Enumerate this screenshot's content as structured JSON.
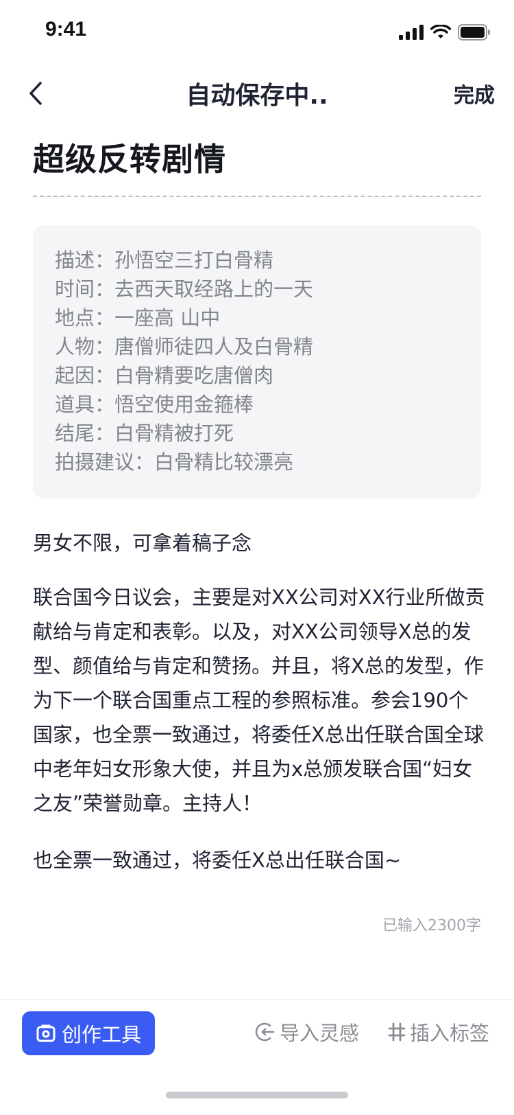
{
  "status_bar": {
    "time": "9:41"
  },
  "nav": {
    "title": "自动保存中..",
    "done_label": "完成"
  },
  "document": {
    "title": "超级反转剧情",
    "info": [
      {
        "label": "描述：",
        "value": "孙悟空三打白骨精"
      },
      {
        "label": "时间：",
        "value": "去西天取经路上的一天"
      },
      {
        "label": "地点：",
        "value": "一座高 山中"
      },
      {
        "label": "人物：",
        "value": "唐僧师徒四人及白骨精"
      },
      {
        "label": "起因：",
        "value": "白骨精要吃唐僧肉"
      },
      {
        "label": "道具：",
        "value": "悟空使用金箍棒"
      },
      {
        "label": "结尾：",
        "value": "白骨精被打死"
      },
      {
        "label": "拍摄建议：",
        "value": "白骨精比较漂亮"
      }
    ],
    "paragraphs": [
      "男女不限，可拿着稿子念",
      "联合国今日议会，主要是对XX公司对XX行业所做贡献给与肯定和表彰。以及，对XX公司领导X总的发型、颜值给与肯定和赞扬。并且，将X总的发型，作为下一个联合国重点工程的参照标准。参会190个国家，也全票一致通过，将委任X总出任联合国全球中老年妇女形象大使，并且为x总颁发联合国“妇女之友”荣誉勋章。主持人！",
      "也全票一致通过，将委任X总出任联合国~"
    ],
    "word_count": "已输入2300字"
  },
  "toolbar": {
    "create_tools_label": "创作工具",
    "import_label": "导入灵感",
    "tag_label": "插入标签"
  },
  "colors": {
    "accent": "#3a5cf2",
    "text": "#1f2233",
    "muted": "#83858d"
  },
  "icons": {
    "back": "chevron-left-icon",
    "create_tools": "toolbox-icon",
    "import": "import-circle-icon",
    "tag": "hashtag-icon"
  }
}
